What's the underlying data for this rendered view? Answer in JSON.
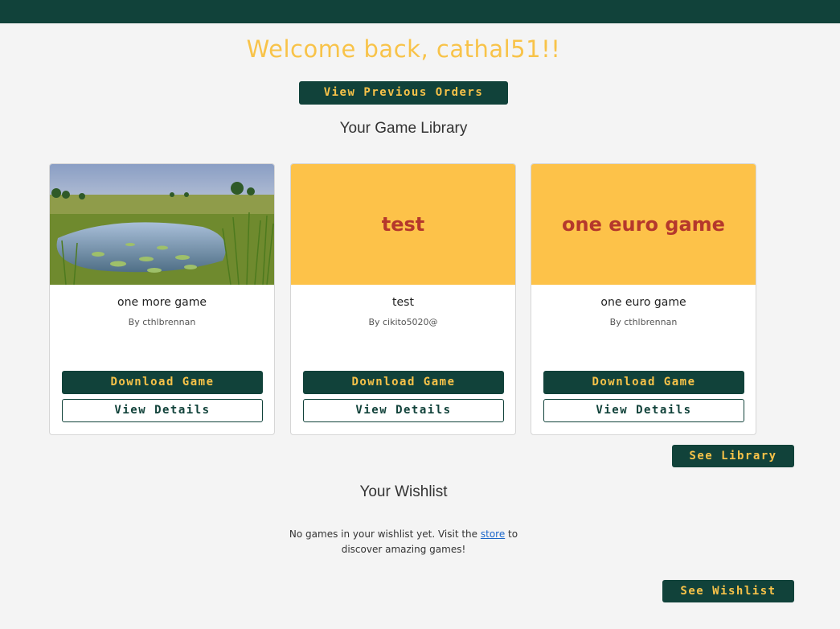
{
  "header": {
    "welcome": "Welcome back, cathal51!!"
  },
  "orders_button": "View Previous Orders",
  "library": {
    "title": "Your Game Library",
    "games": [
      {
        "name": "one more game",
        "author": "By cthlbrennan",
        "cover_text": "",
        "download": "Download Game",
        "details": "View Details"
      },
      {
        "name": "test",
        "author": "By cikito5020@",
        "cover_text": "test",
        "download": "Download Game",
        "details": "View Details"
      },
      {
        "name": "one euro game",
        "author": "By cthlbrennan",
        "cover_text": "one euro game",
        "download": "Download Game",
        "details": "View Details"
      }
    ],
    "see_library": "See Library"
  },
  "wishlist": {
    "title": "Your Wishlist",
    "empty_before": "No games in your wishlist yet. Visit the ",
    "store_link": "store",
    "empty_after": " to discover amazing games!",
    "see_wishlist": "See Wishlist"
  },
  "colors": {
    "brand_dark": "#11423a",
    "accent_yellow": "#f8c349",
    "cover_text_red": "#b5382c"
  }
}
